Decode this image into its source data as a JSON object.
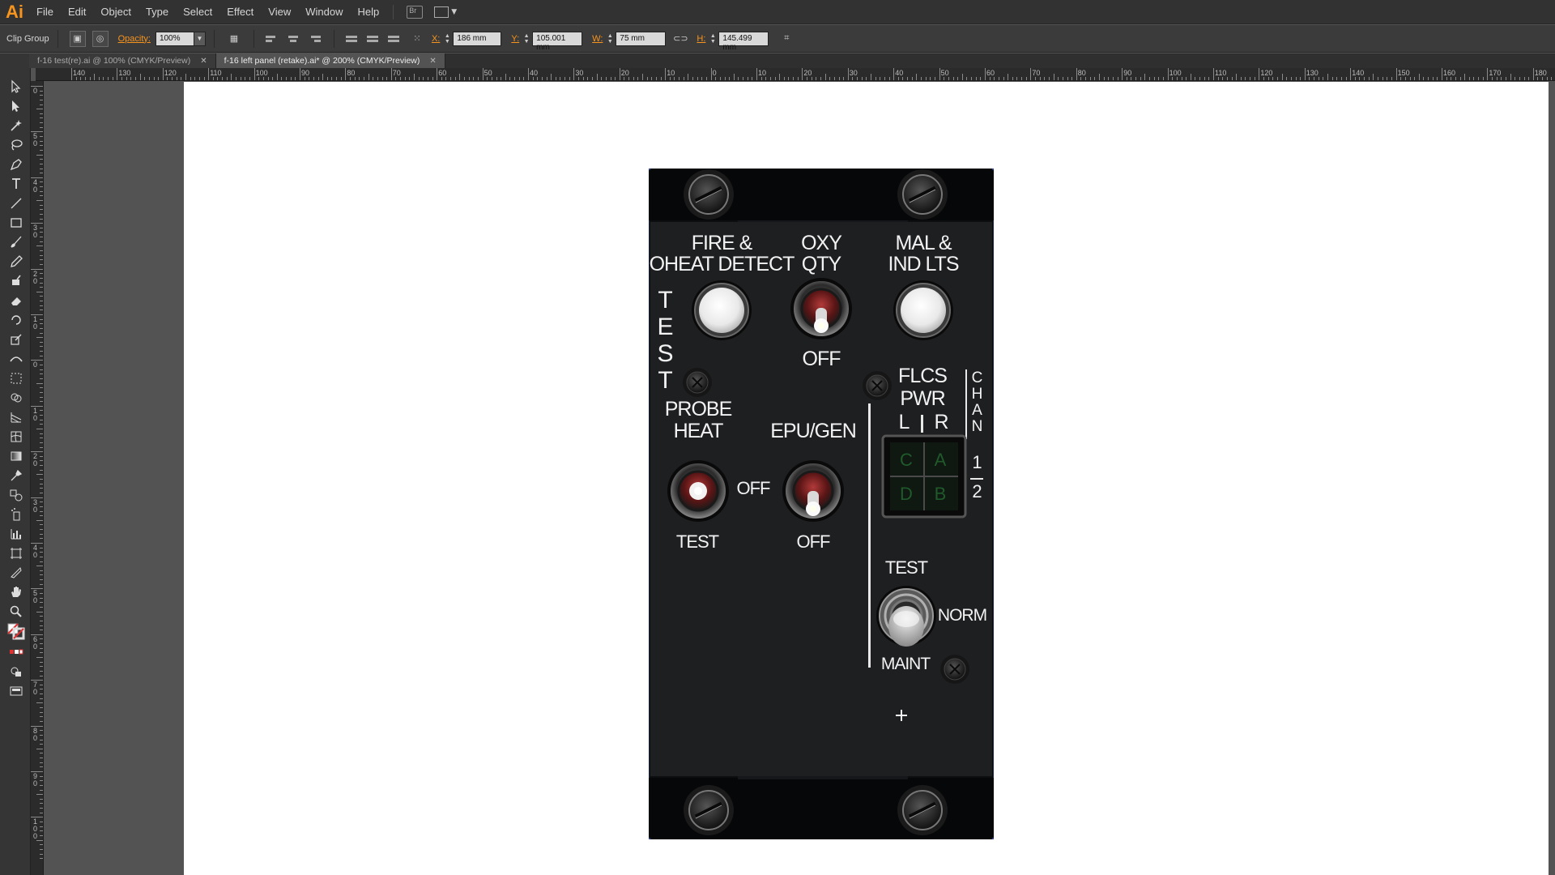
{
  "app": {
    "logo": "Ai"
  },
  "menu": [
    "File",
    "Edit",
    "Object",
    "Type",
    "Select",
    "Effect",
    "View",
    "Window",
    "Help"
  ],
  "control_bar": {
    "selection_label": "Clip Group",
    "opacity_label": "Opacity:",
    "opacity_value": "100%",
    "x_label": "X:",
    "x_value": "186 mm",
    "y_label": "Y:",
    "y_value": "105.001 mm",
    "w_label": "W:",
    "w_value": "75 mm",
    "h_label": "H:",
    "h_value": "145.499 mm"
  },
  "tabs": [
    {
      "label": "f-16 test(re).ai @ 100% (CMYK/Preview)",
      "active": false
    },
    {
      "label": "f-16 left panel (retake).ai* @ 200% (CMYK/Preview)",
      "active": true
    }
  ],
  "ruler_h": [
    "140",
    "130",
    "120",
    "110",
    "100",
    "90",
    "80",
    "70",
    "60",
    "50",
    "40",
    "30",
    "20",
    "10",
    "0",
    "10",
    "20",
    "30",
    "40",
    "50",
    "60",
    "70",
    "80",
    "90",
    "100",
    "110",
    "120",
    "130",
    "140",
    "150",
    "160",
    "170",
    "180"
  ],
  "ruler_v": [
    "0",
    "5\n0",
    "4\n0",
    "3\n0",
    "2\n0",
    "1\n0",
    "0",
    "1\n0",
    "2\n0",
    "3\n0",
    "4\n0",
    "5\n0",
    "6\n0",
    "7\n0",
    "8\n0",
    "9\n0",
    "1\n0\n0"
  ],
  "panel": {
    "fire_label_1": "FIRE &",
    "fire_label_2": "OHEAT DETECT",
    "oxy_label_1": "OXY",
    "oxy_label_2": "QTY",
    "oxy_off": "OFF",
    "mal_label_1": "MAL &",
    "mal_label_2": "IND LTS",
    "test_vertical": [
      "T",
      "E",
      "S",
      "T"
    ],
    "probe_label_1": "PROBE",
    "probe_label_2": "HEAT",
    "probe_off": "OFF",
    "probe_test": "TEST",
    "epu_label": "EPU/GEN",
    "epu_off": "OFF",
    "flcs_label_1": "FLCS",
    "flcs_label_2": "PWR",
    "flcs_l": "L",
    "flcs_r": "R",
    "chan_vertical": [
      "C",
      "H",
      "A",
      "N"
    ],
    "chan_1": "1",
    "chan_2": "2",
    "flcs_cells": [
      "C",
      "A",
      "D",
      "B"
    ],
    "switch_test": "TEST",
    "switch_norm": "NORM",
    "switch_maint": "MAINT"
  },
  "colors": {
    "panel_bg": "#1c1d1f",
    "label_text": "#f2f2f2",
    "flcs_led": "#1f5a2a",
    "accent": "#f7941d"
  }
}
